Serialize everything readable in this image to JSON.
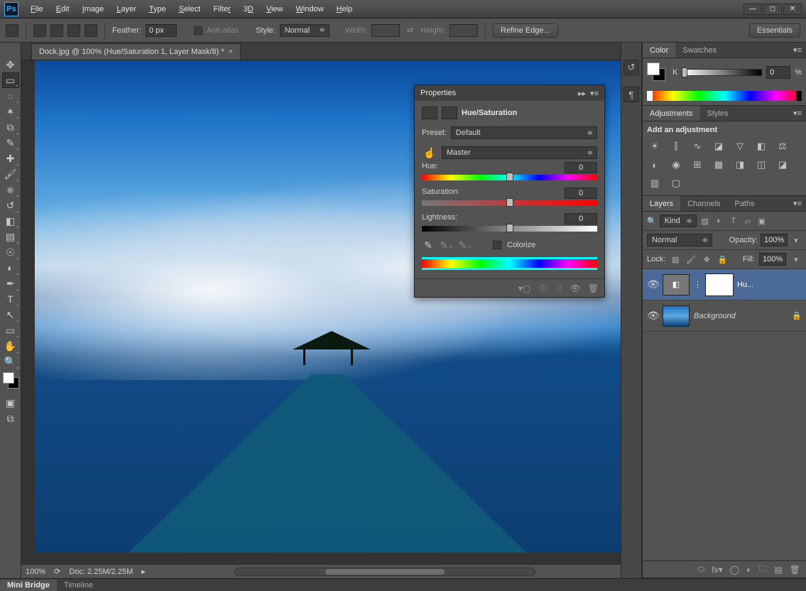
{
  "menu": [
    "File",
    "Edit",
    "Image",
    "Layer",
    "Type",
    "Select",
    "Filter",
    "3D",
    "View",
    "Window",
    "Help"
  ],
  "option_bar": {
    "feather_label": "Feather:",
    "feather_value": "0 px",
    "anti_alias": "Anti-alias",
    "style_label": "Style:",
    "style_value": "Normal",
    "width_label": "Width:",
    "height_label": "Height:",
    "refine": "Refine Edge...",
    "workspace": "Essentials"
  },
  "document": {
    "tab_title": "Dock.jpg @ 100% (Hue/Saturation 1, Layer Mask/8) *",
    "zoom": "100%",
    "doc_info": "Doc: 2.25M/2.25M"
  },
  "properties": {
    "panel_title": "Properties",
    "type_label": "Hue/Saturation",
    "preset_label": "Preset:",
    "preset_value": "Default",
    "channel_value": "Master",
    "hue_label": "Hue:",
    "hue_value": "0",
    "sat_label": "Saturation:",
    "sat_value": "0",
    "light_label": "Lightness:",
    "light_value": "0",
    "colorize": "Colorize"
  },
  "color_panel": {
    "tab1": "Color",
    "tab2": "Swatches",
    "channel": "K",
    "value": "0",
    "unit": "%"
  },
  "adjustments_panel": {
    "tab1": "Adjustments",
    "tab2": "Styles",
    "heading": "Add an adjustment"
  },
  "layers_panel": {
    "tabs": [
      "Layers",
      "Channels",
      "Paths"
    ],
    "filter": "Kind",
    "blend": "Normal",
    "opacity_label": "Opacity:",
    "opacity_value": "100%",
    "lock_label": "Lock:",
    "fill_label": "Fill:",
    "fill_value": "100%",
    "layers": [
      {
        "name": "Hu...",
        "type": "adjustment",
        "selected": true
      },
      {
        "name": "Background",
        "type": "image",
        "locked": true
      }
    ]
  },
  "bottom_tabs": [
    "Mini Bridge",
    "Timeline"
  ]
}
